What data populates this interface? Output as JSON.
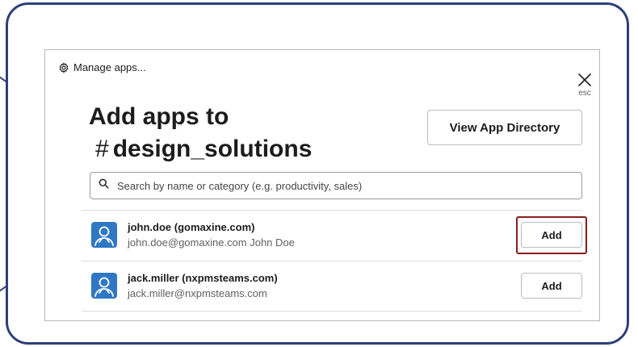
{
  "header": {
    "manage_label": "Manage apps...",
    "close_hint": "esc"
  },
  "title": {
    "line1": "Add apps to",
    "hash": "#",
    "channel": "design_solutions"
  },
  "directory_button": "View App Directory",
  "search": {
    "placeholder": "Search by name or category (e.g. productivity, sales)",
    "value": ""
  },
  "apps": [
    {
      "name": "john.doe (gomaxine.com)",
      "subtitle": "john.doe@gomaxine.com John Doe",
      "action": "Add",
      "highlighted": true
    },
    {
      "name": "jack.miller (nxpmsteams.com)",
      "subtitle": "jack.miller@nxpmsteams.com",
      "action": "Add",
      "highlighted": false
    }
  ],
  "icons": {
    "manage": "gear-icon",
    "close": "close-icon",
    "search": "search-icon",
    "avatar": "user-avatar-icon"
  },
  "colors": {
    "frame": "#2e3f7a",
    "highlight": "#8b1c1c",
    "avatar": "#2f78c4"
  }
}
